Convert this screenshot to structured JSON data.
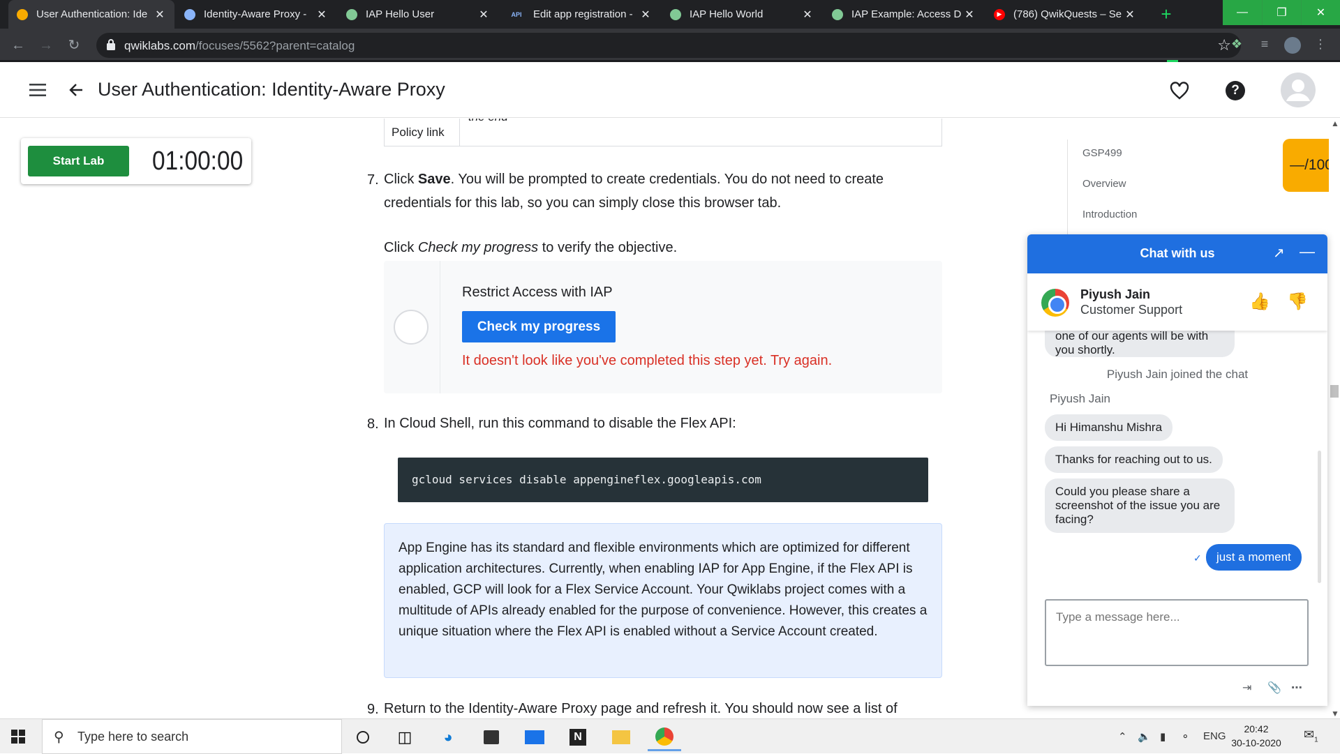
{
  "browser": {
    "tabs": [
      {
        "title": "User Authentication: Ide",
        "favicon": "qwiklabs-icon",
        "color": "#f9ab00",
        "active": true
      },
      {
        "title": "Identity-Aware Proxy -",
        "favicon": "shield-icon",
        "color": "#8ab4f8",
        "active": false
      },
      {
        "title": "IAP Hello User",
        "favicon": "globe-icon",
        "color": "#81c995",
        "active": false
      },
      {
        "title": "Edit app registration -",
        "favicon": "api-icon",
        "color": "#8ab4f8",
        "active": false
      },
      {
        "title": "IAP Hello World",
        "favicon": "globe-icon",
        "color": "#81c995",
        "active": false
      },
      {
        "title": "IAP Example: Access D",
        "favicon": "globe-icon",
        "color": "#81c995",
        "active": false
      },
      {
        "title": "(786) QwikQuests – Se",
        "favicon": "youtube-icon",
        "color": "#ff0000",
        "active": false
      }
    ],
    "url_domain": "qwiklabs.com",
    "url_path": "/focuses/5562?parent=catalog"
  },
  "header": {
    "title": "User Authentication: Identity-Aware Proxy"
  },
  "lab": {
    "start_label": "Start Lab",
    "timer": "01:00:00"
  },
  "content": {
    "table_label": "Policy link",
    "table_value": "the end",
    "step7_num": "7.",
    "step7_a": "Click ",
    "step7_bold": "Save",
    "step7_b": ". You will be prompted to create credentials. You do not need to create",
    "step7_line2": "credentials for this lab, so you can simply close this browser tab.",
    "check_pre": "Click ",
    "check_italic": "Check my progress",
    "check_post": " to verify the objective.",
    "progress_title": "Restrict Access with IAP",
    "progress_button": "Check my progress",
    "progress_error": "It doesn't look like you've completed this step yet. Try again.",
    "step8_num": "8.",
    "step8_text": "In Cloud Shell, run this command to disable the Flex API:",
    "code": "gcloud services disable appengineflex.googleapis.com",
    "note": "App Engine has its standard and flexible environments which are optimized for different application architectures. Currently, when enabling IAP for App Engine, if the Flex API is enabled, GCP will look for a Flex Service Account. Your Qwiklabs project comes with a multitude of APIs already enabled for the purpose of convenience. However, this creates a unique situation where the Flex API is enabled without a Service Account created.",
    "step9_num": "9.",
    "step9_text": "Return to the Identity-Aware Proxy page and refresh it. You should now see a list of"
  },
  "toc": {
    "items": [
      "GSP499",
      "Overview",
      "Introduction"
    ],
    "score": "—/100"
  },
  "chat": {
    "title": "Chat with us",
    "agent_name": "Piyush Jain",
    "agent_role": "Customer Support",
    "partial_msg_1": "one of our agents will be with",
    "partial_msg_2": "you shortly.",
    "joined": "Piyush Jain joined the chat",
    "sender": "Piyush Jain",
    "msg1": "Hi Himanshu Mishra",
    "msg2": "Thanks for reaching out to us.",
    "msg3": "Could you please share a screenshot of the issue you are facing?",
    "reply": "just a moment",
    "input_placeholder": "Type a message here..."
  },
  "taskbar": {
    "search_placeholder": "Type here to search",
    "lang": "ENG",
    "time": "20:42",
    "date": "30-10-2020",
    "notifications": "1"
  }
}
